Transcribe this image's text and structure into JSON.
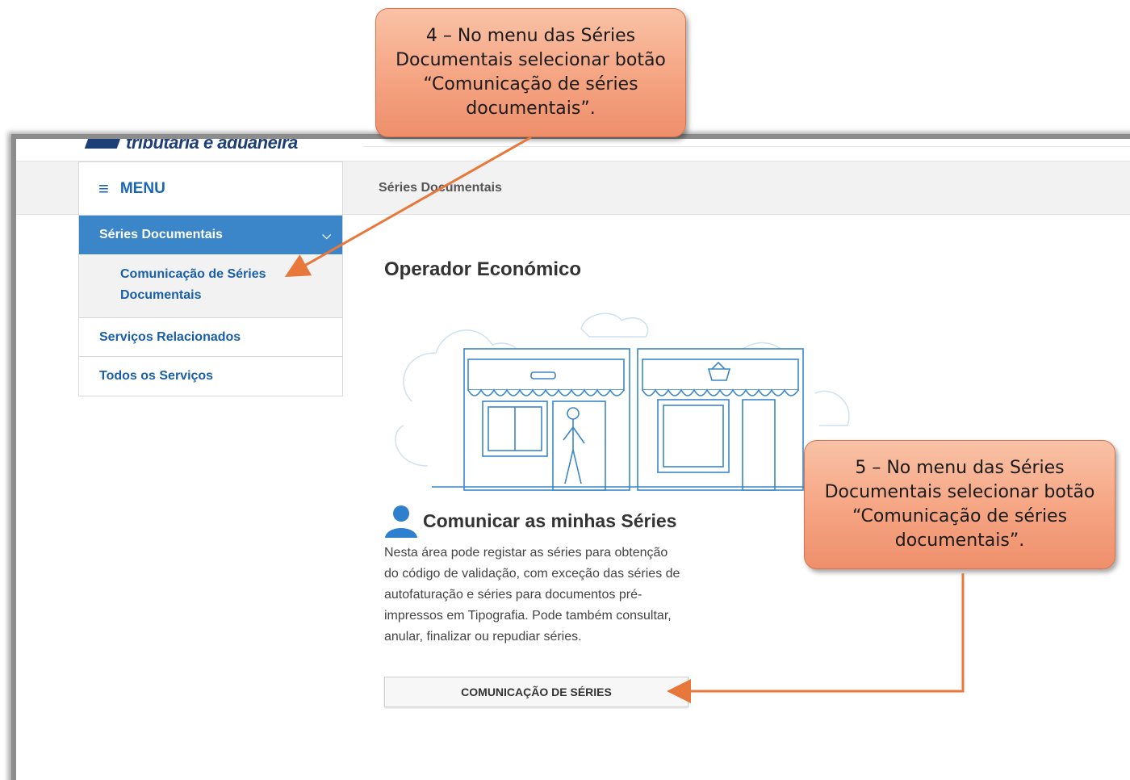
{
  "header": {
    "logo_text": "tributária e aduaneira"
  },
  "breadcrumb": "Séries Documentais",
  "menu": {
    "title": "MENU",
    "active": "Séries Documentais",
    "sub_item": "Comunicação de Séries Documentais",
    "items": [
      "Serviços Relacionados",
      "Todos os Serviços"
    ]
  },
  "main": {
    "title": "Operador Económico",
    "section_title": "Comunicar as minhas Séries",
    "description": "Nesta área pode registar as séries para obtenção do código de validação, com exceção das séries de autofaturação e séries para documentos pré-impressos em Tipografia. Pode também consultar, anular, finalizar ou repudiar séries.",
    "button": "COMUNICAÇÃO DE SÉRIES"
  },
  "callouts": {
    "step4": "4 – No menu das Séries Documentais selecionar botão “Comunicação de séries documentais”.",
    "step5": "5 – No menu das Séries Documentais selecionar botão “Comunicação de séries documentais”."
  },
  "colors": {
    "accent": "#3a86c8",
    "link": "#1a5fa8",
    "callout": "#f5a482",
    "arrow": "#e8773b"
  }
}
